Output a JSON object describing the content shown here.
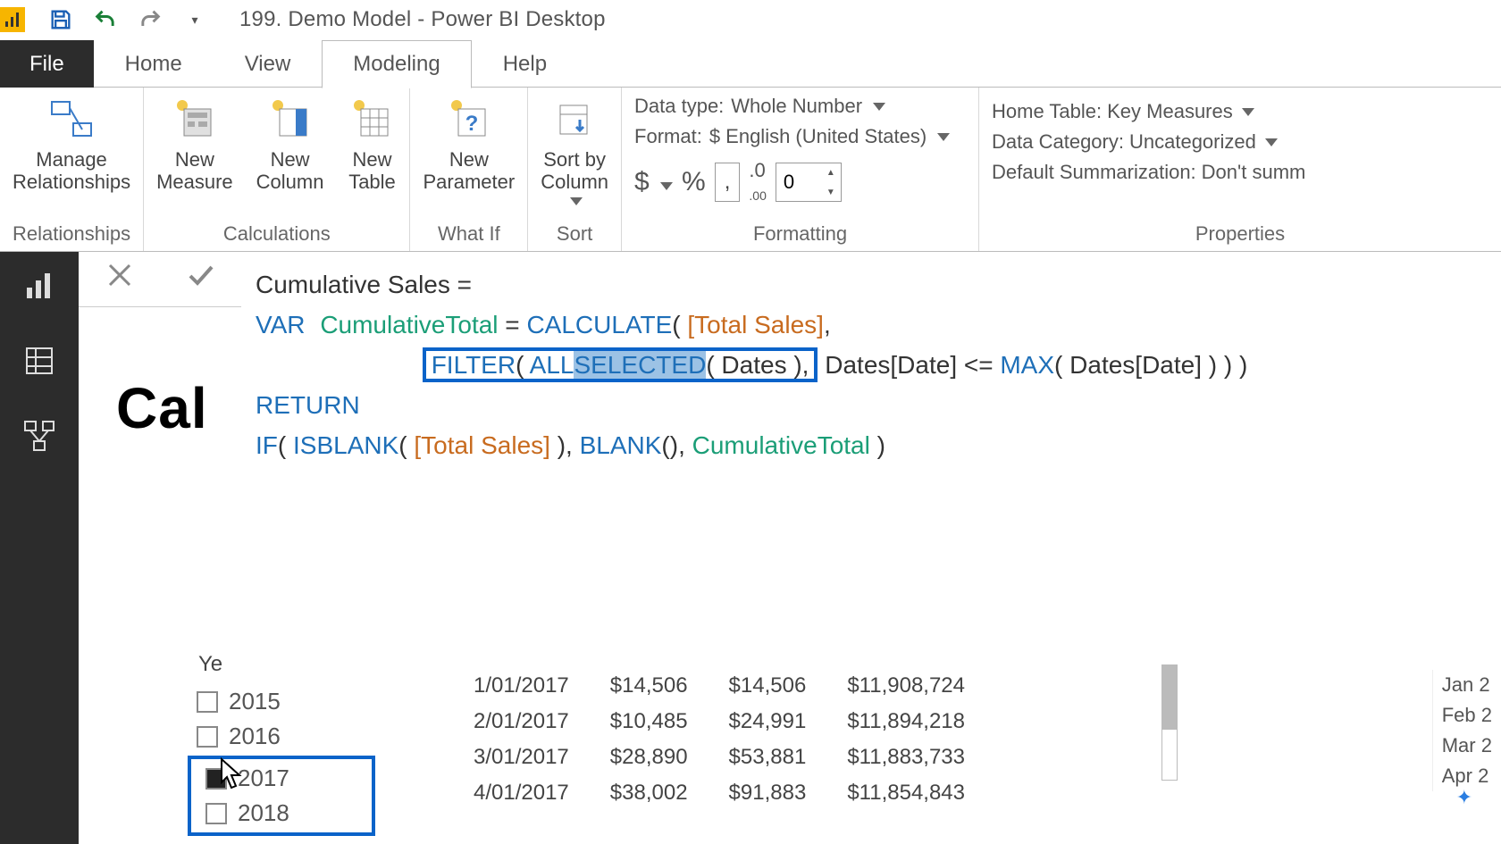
{
  "title": "199. Demo Model - Power BI Desktop",
  "tabs": {
    "file": "File",
    "home": "Home",
    "view": "View",
    "modeling": "Modeling",
    "help": "Help"
  },
  "ribbon": {
    "relationships": {
      "manage": "Manage\nRelationships",
      "label": "Relationships"
    },
    "calc": {
      "measure": "New\nMeasure",
      "column": "New\nColumn",
      "table": "New\nTable",
      "label": "Calculations"
    },
    "whatif": {
      "param": "New\nParameter",
      "label": "What If"
    },
    "sort": {
      "sortby": "Sort by\nColumn",
      "label": "Sort"
    },
    "fmt": {
      "dtype_label": "Data type:",
      "dtype_value": "Whole Number",
      "format_label": "Format:",
      "format_value": "$ English (United States)",
      "dollar": "$",
      "percent": "%",
      "comma": ",",
      "dec": ".00",
      "decval": "0",
      "label": "Formatting"
    },
    "props": {
      "home_label": "Home Table:",
      "home_value": "Key Measures",
      "cat_label": "Data Category:",
      "cat_value": "Uncategorized",
      "sum_label": "Default Summarization:",
      "sum_value": "Don't summ",
      "label": "Properties"
    }
  },
  "formula": {
    "l1a": "Cumulative Sales = ",
    "l2_var": "VAR",
    "l2_ident": "CumulativeTotal",
    "l2_eq": " = ",
    "l2_calc": "CALCULATE",
    "l2_paren": "( ",
    "l2_meas": "[Total Sales]",
    "l2_end": ",",
    "l3_pad": "                        ",
    "l3_filter": "FILTER",
    "l3_p1": "( ",
    "l3_all": "ALL",
    "l3_sel": "SELECTED",
    "l3_p2": "( ",
    "l3_dates": "Dates",
    "l3_p3": " ),",
    "l3_rest1": " Dates[Date] <= ",
    "l3_max": "MAX",
    "l3_rest2": "( Dates[Date] ) ) )",
    "l4_return": "RETURN",
    "l5_if": "IF",
    "l5_p1": "( ",
    "l5_isblank": "ISBLANK",
    "l5_p2": "( ",
    "l5_meas": "[Total Sales]",
    "l5_p3": " ), ",
    "l5_blank": "BLANK",
    "l5_p4": "(), ",
    "l5_ident": "CumulativeTotal",
    "l5_end": " )"
  },
  "page_heading": "Cal",
  "slicer": {
    "label": "Ye",
    "items": [
      "2015",
      "2016",
      "2017",
      "2018"
    ]
  },
  "table": {
    "rows": [
      {
        "date": "1/01/2017",
        "v1": "$14,506",
        "v2": "$14,506",
        "v3": "$11,908,724"
      },
      {
        "date": "2/01/2017",
        "v1": "$10,485",
        "v2": "$24,991",
        "v3": "$11,894,218"
      },
      {
        "date": "3/01/2017",
        "v1": "$28,890",
        "v2": "$53,881",
        "v3": "$11,883,733"
      },
      {
        "date": "4/01/2017",
        "v1": "$38,002",
        "v2": "$91,883",
        "v3": "$11,854,843"
      }
    ]
  },
  "months": [
    "Jan 2",
    "Feb 2",
    "Mar 2",
    "Apr 2"
  ]
}
